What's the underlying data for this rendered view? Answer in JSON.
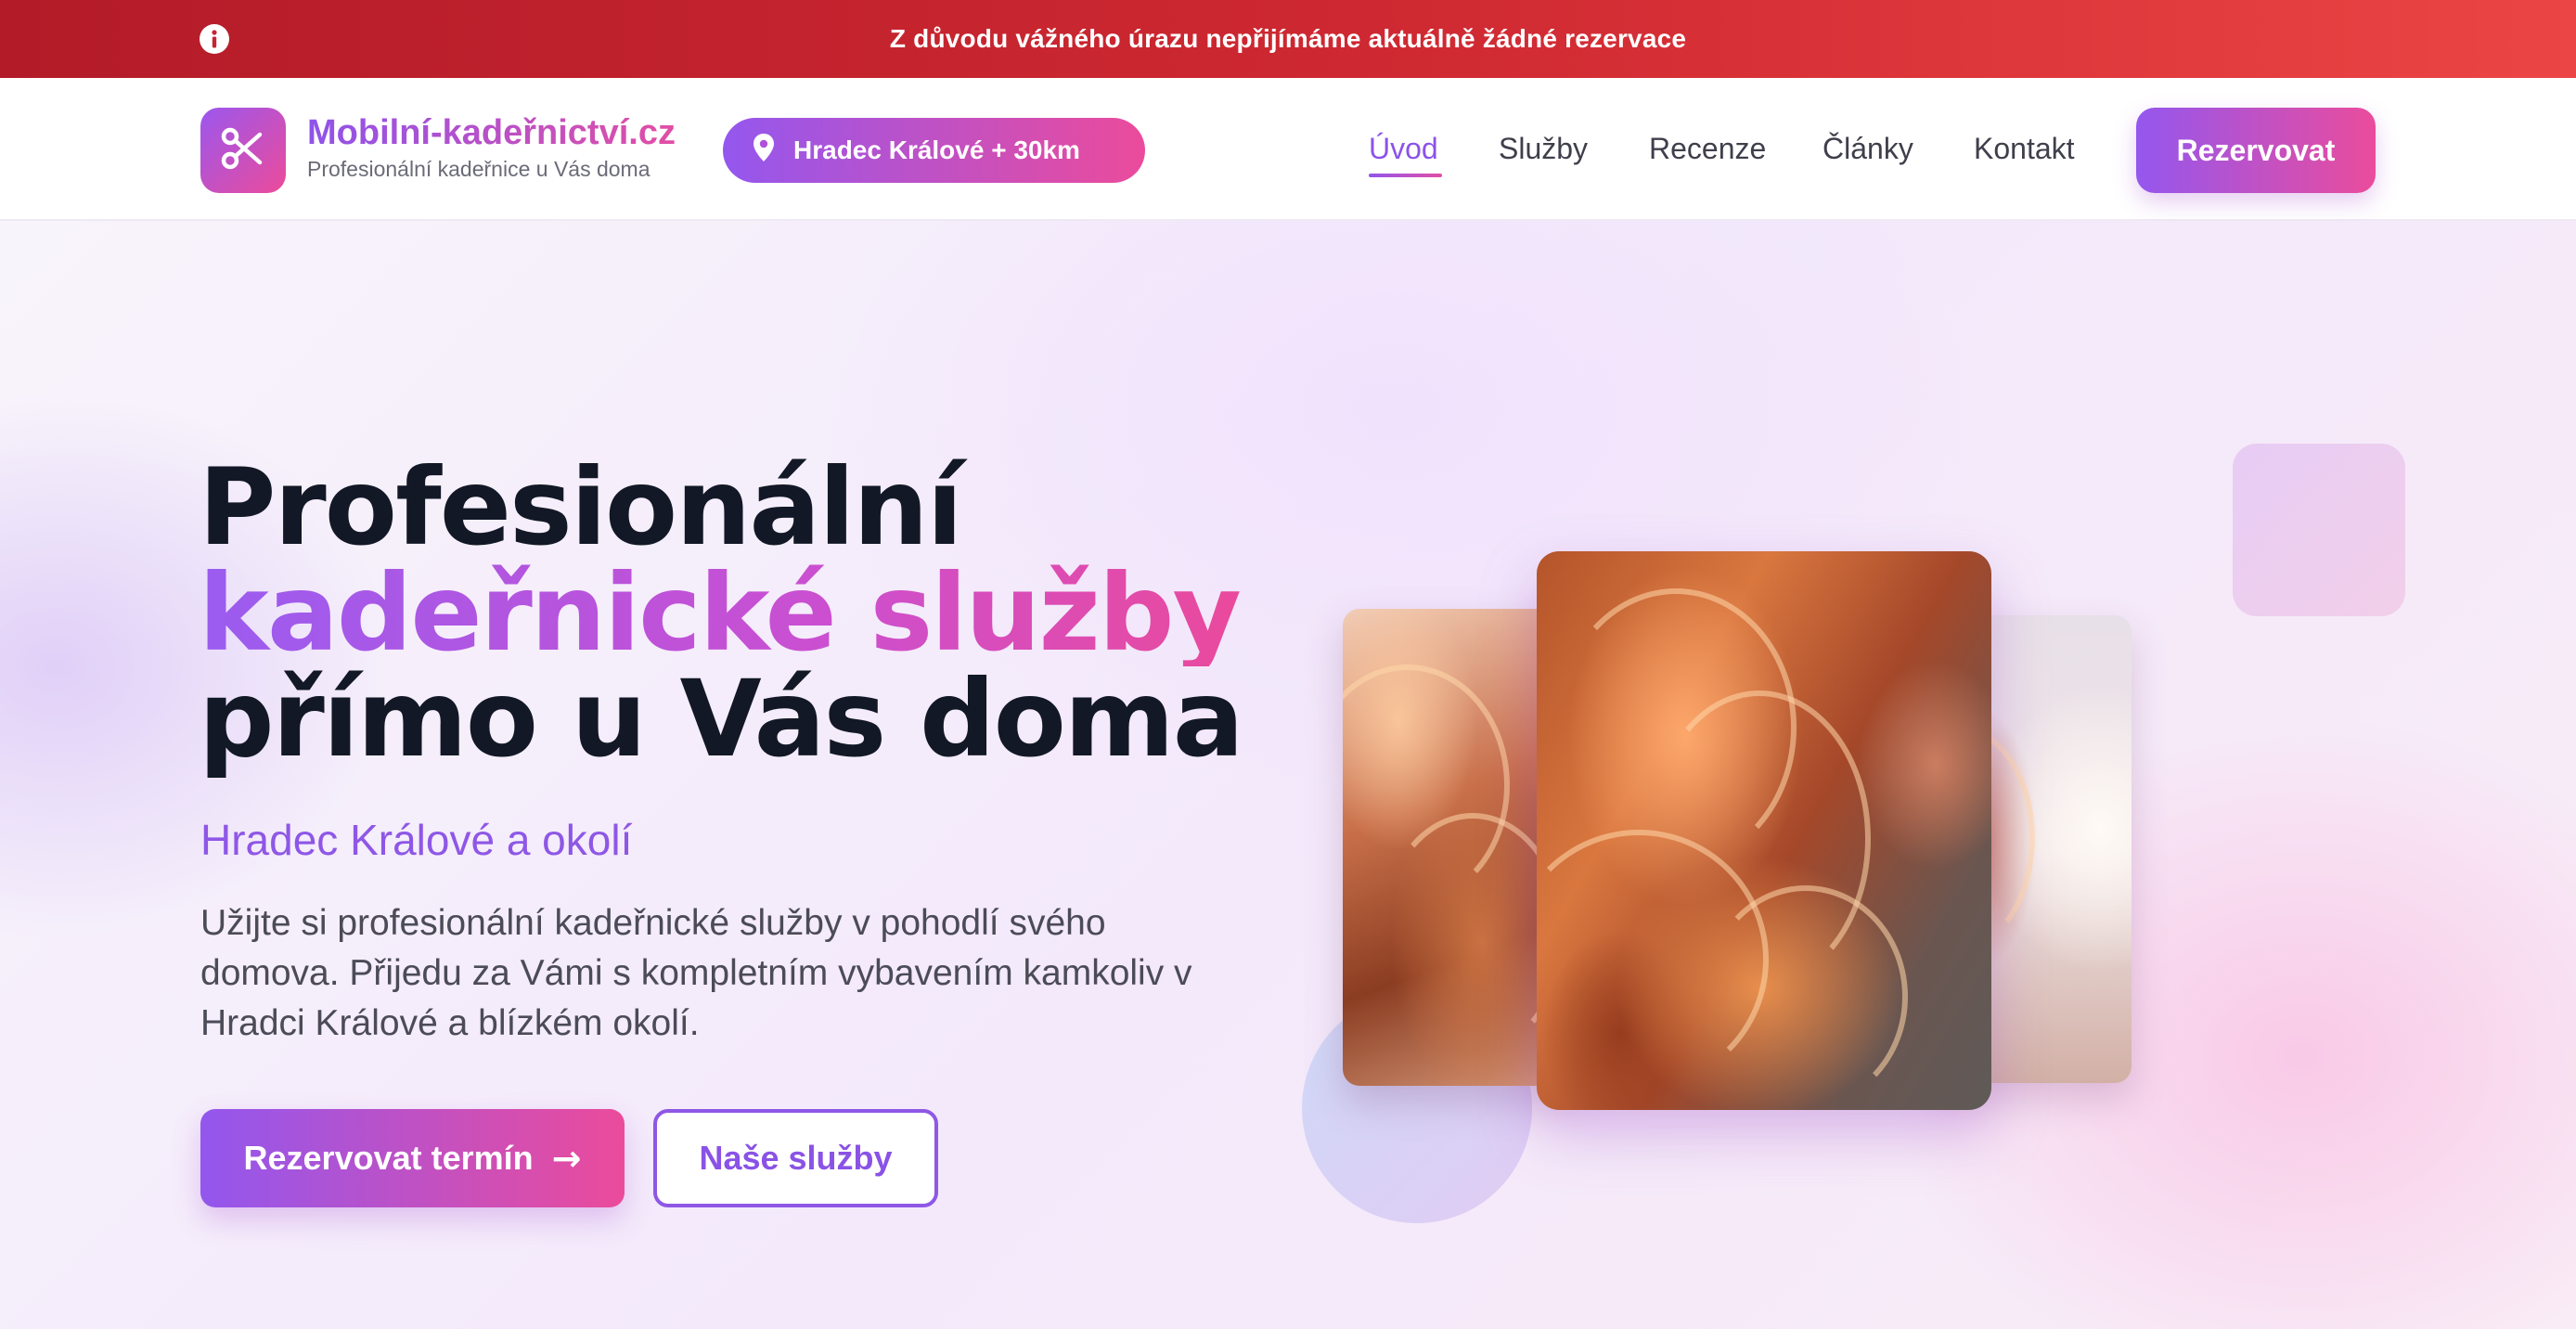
{
  "alert": {
    "icon": "info-icon",
    "text": "Z důvodu vážného úrazu nepřijímáme aktuálně žádné rezervace",
    "colors": [
      "#b31b28",
      "#ec4545"
    ]
  },
  "header": {
    "logo_icon": "scissors-icon",
    "brand_name": "Mobilní-kadeřnictví.cz",
    "tagline": "Profesionální kadeřnice u Vás doma",
    "location": {
      "icon": "map-pin-icon",
      "label": "Hradec Králové + 30km"
    },
    "nav": [
      {
        "label": "Úvod",
        "active": true
      },
      {
        "label": "Služby",
        "active": false
      },
      {
        "label": "Recenze",
        "active": false
      },
      {
        "label": "Články",
        "active": false
      },
      {
        "label": "Kontakt",
        "active": false
      }
    ],
    "cta_label": "Rezervovat"
  },
  "hero": {
    "title_line1": "Profesionální",
    "title_line2": "kadeřnické služby",
    "title_line3": "přímo u Vás doma",
    "subtitle": "Hradec Králové a okolí",
    "description": "Užijte si profesionální kadeřnické služby v pohodlí svého domova. Přijedu za Vámi s kompletním vybavením kamkoliv v Hradci Králové a blízkém okolí.",
    "primary_button": "Rezervovat termín",
    "primary_button_icon": "arrow-right-icon",
    "secondary_button": "Naše služby"
  },
  "colors": {
    "accent_purple": "#8e57e6",
    "accent_pink": "#ea4b9c",
    "heading_dark": "#121826",
    "alert_red": "#cf2932"
  }
}
